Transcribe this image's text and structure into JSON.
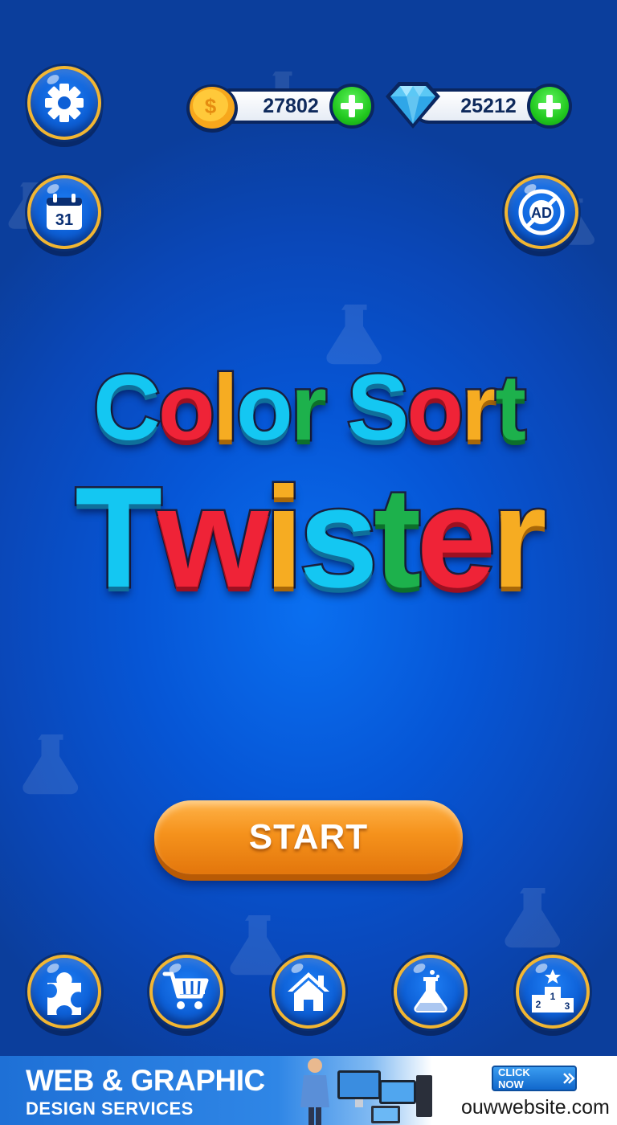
{
  "header": {
    "coins": {
      "amount": "27802",
      "icon": "coin-icon"
    },
    "gems": {
      "amount": "25212",
      "icon": "diamond-icon"
    }
  },
  "side_buttons": {
    "settings": "gear-icon",
    "daily": {
      "icon": "calendar-icon",
      "day": "31"
    },
    "no_ads": {
      "icon": "no-ads-icon",
      "label": "AD"
    }
  },
  "title": {
    "line1": [
      {
        "text": "C",
        "color": "cyan"
      },
      {
        "text": "o",
        "color": "red"
      },
      {
        "text": "l",
        "color": "orange"
      },
      {
        "text": "o",
        "color": "cyan"
      },
      {
        "text": "r",
        "color": "green"
      },
      {
        "text": " ",
        "color": "cyan"
      },
      {
        "text": "S",
        "color": "cyan"
      },
      {
        "text": "o",
        "color": "red"
      },
      {
        "text": "r",
        "color": "orange"
      },
      {
        "text": "t",
        "color": "green"
      }
    ],
    "line2": [
      {
        "text": "T",
        "color": "cyan"
      },
      {
        "text": "w",
        "color": "red"
      },
      {
        "text": "i",
        "color": "orange"
      },
      {
        "text": "s",
        "color": "cyan"
      },
      {
        "text": "t",
        "color": "green"
      },
      {
        "text": "e",
        "color": "red"
      },
      {
        "text": "r",
        "color": "orange"
      }
    ]
  },
  "start_button": {
    "label": "START"
  },
  "bottom_nav": [
    {
      "icon": "puzzle-icon"
    },
    {
      "icon": "cart-icon"
    },
    {
      "icon": "home-icon"
    },
    {
      "icon": "flask-icon"
    },
    {
      "icon": "podium-icon",
      "numbers": [
        "1",
        "2",
        "3"
      ]
    }
  ],
  "ad_banner": {
    "title": "WEB & GRAPHIC",
    "subtitle": "DESIGN SERVICES",
    "cta": "CLICK NOW",
    "url": "ouwwebsite.com"
  },
  "colors": {
    "background": "#0656d6",
    "ring": "#f2b632",
    "start": "#f5921c",
    "plus": "#22c81f",
    "cyan": "#14c7f2",
    "red": "#ef2337",
    "orange": "#f6ac22",
    "green": "#1db14c"
  }
}
